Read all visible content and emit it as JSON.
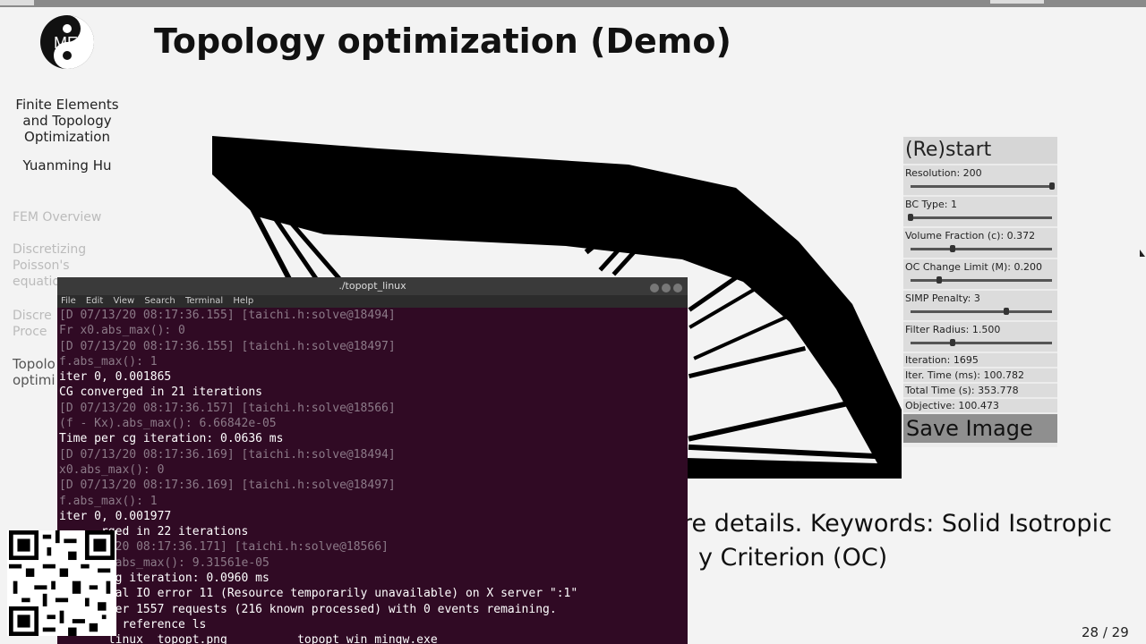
{
  "slide": {
    "title": "Topology optimization (Demo)",
    "logo_text": "MES",
    "sidebar": {
      "course_line1": "Finite Elements",
      "course_line2": "and Topology",
      "course_line3": "Optimization",
      "author": "Yuanming Hu",
      "toc_item1": "FEM Overview",
      "toc_item2a": "Discretizing",
      "toc_item2b": "Poisson's",
      "toc_item2c": "equation",
      "toc_item3a": "Discre",
      "toc_item3b": "Proce",
      "toc_item4a": "Topolo",
      "toc_item4b": "optimi"
    },
    "caption_line1": "re details. Keywords: Solid Isotropic",
    "caption_line2": "y Criterion (OC)",
    "page_number": "28 / 29"
  },
  "control_panel": {
    "restart_label": "(Re)start",
    "sliders": [
      {
        "label": "Resolution: 200",
        "fraction": 1.0
      },
      {
        "label": "BC Type: 1",
        "fraction": 0.0
      },
      {
        "label": "Volume Fraction (c): 0.372",
        "fraction": 0.3
      },
      {
        "label": "OC Change Limit (M): 0.200",
        "fraction": 0.2
      },
      {
        "label": "SIMP Penalty: 3",
        "fraction": 0.68
      },
      {
        "label": "Filter Radius: 1.500",
        "fraction": 0.3
      }
    ],
    "iteration": "Iteration: 1695",
    "iter_time": "Iter. Time (ms): 100.782",
    "total_time": "Total Time (s): 353.778",
    "objective": "Objective: 100.473",
    "save_label": "Save Image"
  },
  "terminal": {
    "title": "./topopt_linux",
    "menu": [
      "File",
      "Edit",
      "View",
      "Search",
      "Terminal",
      "Help"
    ],
    "lines": [
      {
        "text": "[D 07/13/20 08:17:36.155] [taichi.h:solve@18494]",
        "dim": true
      },
      {
        "text": "Fr x0.abs_max(): 0",
        "dim": true
      },
      {
        "text": "[D 07/13/20 08:17:36.155] [taichi.h:solve@18497]",
        "dim": true
      },
      {
        "text": "f.abs_max(): 1",
        "dim": true
      },
      {
        "text": "iter 0, 0.001865",
        "dim": false
      },
      {
        "text": "CG converged in 21 iterations",
        "dim": false
      },
      {
        "text": "[D 07/13/20 08:17:36.157] [taichi.h:solve@18566]",
        "dim": true
      },
      {
        "text": "(f - Kx).abs_max(): 6.66842e-05",
        "dim": true
      },
      {
        "text": "Time per cg iteration: 0.0636 ms",
        "dim": false
      },
      {
        "text": "[D 07/13/20 08:17:36.169] [taichi.h:solve@18494]",
        "dim": true
      },
      {
        "text": "x0.abs_max(): 0",
        "dim": true
      },
      {
        "text": "[D 07/13/20 08:17:36.169] [taichi.h:solve@18497]",
        "dim": true
      },
      {
        "text": "f.abs_max(): 1",
        "dim": true
      },
      {
        "text": "iter 0, 0.001977",
        "dim": false
      },
      {
        "text": "      rged in 22 iterations",
        "dim": false
      },
      {
        "text": "       /20 08:17:36.171] [taichi.h:solve@18566]",
        "dim": true
      },
      {
        "text": "       .abs_max(): 9.31561e-05",
        "dim": true
      },
      {
        "text": "       cg iteration: 0.0960 ms",
        "dim": false
      },
      {
        "text": "       tal IO error 11 (Resource temporarily unavailable) on X server \":1\"",
        "dim": false
      },
      {
        "text": "       ter 1557 requests (216 known processed) with 0 events remaining.",
        "dim": false
      },
      {
        "text": "         reference ls",
        "dim": false
      },
      {
        "text": "       linux  topopt.png          topopt_win_mingw.exe",
        "dim": false
      }
    ]
  }
}
